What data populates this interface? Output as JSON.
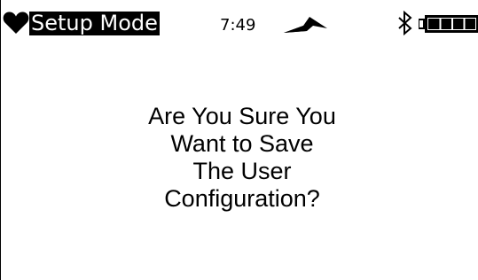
{
  "status_bar": {
    "mode": "Setup Mode",
    "time": "7:49",
    "icons": [
      "heart-icon",
      "signal-icon",
      "bluetooth-icon",
      "battery-icon"
    ],
    "battery_level": 1.0
  },
  "dialog": {
    "lines": [
      "Are You Sure You",
      "Want to Save",
      "The User",
      "Configuration?"
    ]
  },
  "colors": {
    "background": "#ffffff",
    "foreground": "#000000",
    "highlight_background": "#000000",
    "highlight_text": "#ffffff"
  }
}
